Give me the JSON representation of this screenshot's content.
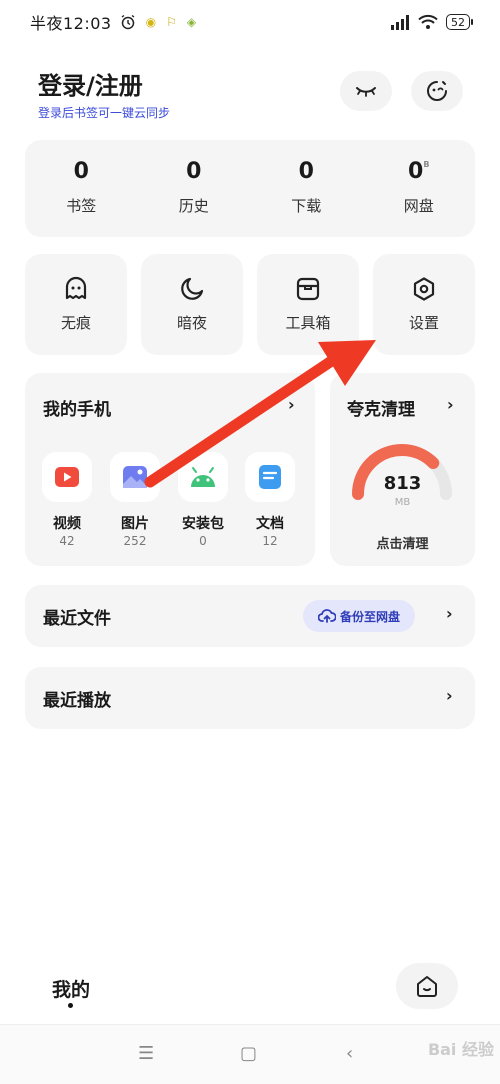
{
  "status_bar": {
    "time": "半夜12:03",
    "battery": "52"
  },
  "header": {
    "title": "登录/注册",
    "subtitle": "登录后书签可一键云同步"
  },
  "stats": [
    {
      "value": "0",
      "label": "书签"
    },
    {
      "value": "0",
      "label": "历史"
    },
    {
      "value": "0",
      "label": "下载"
    },
    {
      "value": "0",
      "unit": "B",
      "label": "网盘"
    }
  ],
  "tools": [
    {
      "label": "无痕",
      "icon": "ghost-icon"
    },
    {
      "label": "暗夜",
      "icon": "moon-icon"
    },
    {
      "label": "工具箱",
      "icon": "toolbox-icon"
    },
    {
      "label": "设置",
      "icon": "settings-icon"
    }
  ],
  "my_phone": {
    "title": "我的手机",
    "apps": [
      {
        "name": "视频",
        "count": "42",
        "icon": "video-icon",
        "color": "#f04b3c"
      },
      {
        "name": "图片",
        "count": "252",
        "icon": "image-icon",
        "color": "#6e7cf0"
      },
      {
        "name": "安装包",
        "count": "0",
        "icon": "android-icon",
        "color": "#3fc27a"
      },
      {
        "name": "文档",
        "count": "12",
        "icon": "document-icon",
        "color": "#3d9cf0"
      }
    ]
  },
  "cleaner": {
    "title": "夸克清理",
    "value": "813",
    "unit": "MB",
    "action": "点击清理",
    "gauge_fraction": 0.75,
    "gauge_color": "#f06a52"
  },
  "recent_files": {
    "title": "最近文件",
    "backup_label": "备份至网盘"
  },
  "recent_play": {
    "title": "最近播放"
  },
  "bottom": {
    "tab_label": "我的"
  },
  "watermark": "Bai 经验"
}
